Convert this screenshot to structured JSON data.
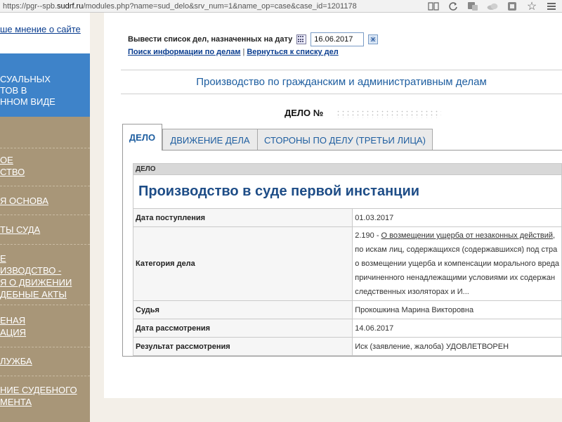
{
  "browser": {
    "url_prefix": "https://pgr--spb.",
    "url_domain": "sudrf.ru",
    "url_rest": "/modules.php?name=sud_delo&srv_num=1&name_op=case&case_id=1201178",
    "icons": [
      "reader-icon",
      "refresh-icon",
      "translate-icon",
      "weather-icon",
      "extension-icon",
      "star-icon"
    ]
  },
  "sidebar": {
    "top_link": "ше мнение о сайте",
    "blue_item": "СУАЛЬНЫХ\nТОВ В\nННОМ ВИДЕ",
    "items": [
      {
        "label": "ОЕ\nСТВО"
      },
      {
        "label": "Я ОСНОВА"
      },
      {
        "label": "ТЫ СУДА"
      },
      {
        "label": "Е\nИЗВОДСТВО -\nЯ О ДВИЖЕНИИ\nДЕБНЫЕ АКТЫ"
      },
      {
        "label": "ЕНАЯ\nАЦИЯ"
      },
      {
        "label": "ЛУЖБА"
      },
      {
        "label": "НИЕ СУДЕБНОГО\nМЕНТА"
      }
    ]
  },
  "filter": {
    "label": "Вывести список дел, назначенных на дату",
    "date_value": "16.06.2017",
    "search_link": "Поиск информации по делам",
    "back_link": "Вернуться к списку дел"
  },
  "section_title": "Производство по гражданским и административным делам",
  "case_number_label": "ДЕЛО №",
  "tabs": [
    {
      "label": "ДЕЛО",
      "active": true
    },
    {
      "label": "ДВИЖЕНИЕ ДЕЛА",
      "active": false
    },
    {
      "label": "СТОРОНЫ ПО ДЕЛУ (ТРЕТЬИ ЛИЦА)",
      "active": false
    }
  ],
  "case": {
    "header": "ДЕЛО",
    "instance_title": "Производство в суде первой инстанции",
    "rows": [
      {
        "label": "Дата поступления",
        "value": "01.03.2017"
      },
      {
        "label": "Категория дела",
        "value_code": "2.190 - ",
        "value_link": "О возмещении ущерба от незаконных действий",
        "value_link_tail": ",",
        "value_lines": [
          "по искам лиц, содержащихся (содержавшихся) под стра",
          "о возмещении ущерба и компенсации морального вреда",
          "причиненного ненадлежащими условиями их содержан",
          "следственных изоляторах и И..."
        ]
      },
      {
        "label": "Судья",
        "value": "Прокошкина Марина Викторовна"
      },
      {
        "label": "Дата рассмотрения",
        "value": "14.06.2017"
      },
      {
        "label": "Результат рассмотрения",
        "value": "Иск (заявление, жалоба) УДОВЛЕТВОРЕН"
      }
    ]
  },
  "colors": {
    "link_blue": "#1e5ea0",
    "sidebar_blue": "#3e83c9",
    "sidebar_brown": "#a89678",
    "page_bg": "#f3efe8"
  }
}
